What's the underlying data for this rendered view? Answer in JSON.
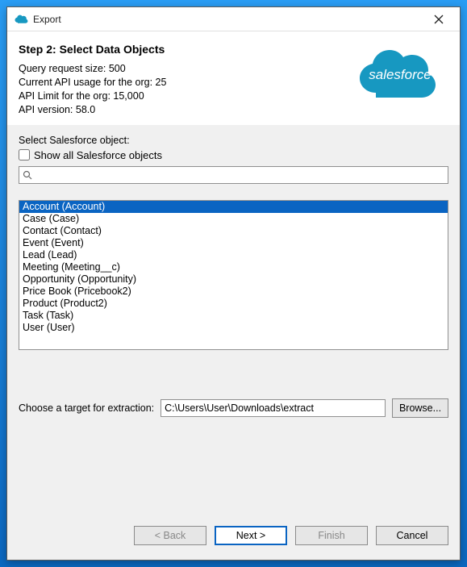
{
  "window": {
    "title": "Export"
  },
  "header": {
    "step_title": "Step 2: Select Data Objects",
    "info": {
      "query_size": "Query request size: 500",
      "api_usage": "Current API usage for the org: 25",
      "api_limit": "API Limit for the org: 15,000",
      "api_version": "API version: 58.0"
    },
    "logo_text": "salesforce"
  },
  "body": {
    "select_label": "Select Salesforce object:",
    "show_all_label": "Show all Salesforce objects",
    "search_placeholder": "",
    "objects": [
      {
        "label": "Account (Account)",
        "selected": true
      },
      {
        "label": "Case (Case)",
        "selected": false
      },
      {
        "label": "Contact (Contact)",
        "selected": false
      },
      {
        "label": "Event (Event)",
        "selected": false
      },
      {
        "label": "Lead (Lead)",
        "selected": false
      },
      {
        "label": "Meeting (Meeting__c)",
        "selected": false
      },
      {
        "label": "Opportunity (Opportunity)",
        "selected": false
      },
      {
        "label": "Price Book (Pricebook2)",
        "selected": false
      },
      {
        "label": "Product (Product2)",
        "selected": false
      },
      {
        "label": "Task (Task)",
        "selected": false
      },
      {
        "label": "User (User)",
        "selected": false
      }
    ],
    "target_label": "Choose a target for extraction:",
    "target_value": "C:\\Users\\User\\Downloads\\extract",
    "browse_label": "Browse..."
  },
  "buttons": {
    "back": "< Back",
    "next": "Next >",
    "finish": "Finish",
    "cancel": "Cancel"
  }
}
